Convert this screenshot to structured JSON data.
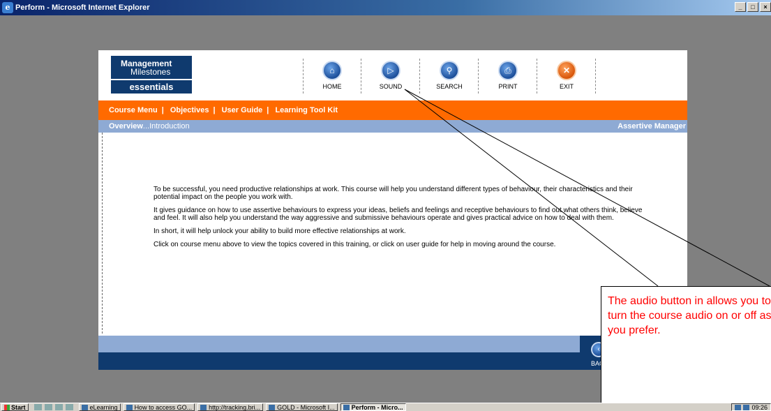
{
  "window": {
    "title": "Perform - Microsoft Internet Explorer",
    "controls": [
      "_",
      "□",
      "×"
    ]
  },
  "logo": {
    "line1": "Management",
    "line2": "Milestones",
    "line3": "essentials"
  },
  "toolbar": [
    {
      "label": "HOME",
      "icon": "home-icon",
      "glyph": "⌂"
    },
    {
      "label": "SOUND",
      "icon": "sound-icon",
      "glyph": "▷"
    },
    {
      "label": "SEARCH",
      "icon": "search-icon",
      "glyph": "⚲"
    },
    {
      "label": "PRINT",
      "icon": "print-icon",
      "glyph": "⎙"
    },
    {
      "label": "EXIT",
      "icon": "exit-icon",
      "glyph": "✕"
    }
  ],
  "menu": [
    "Course Menu",
    "Objectives",
    "User Guide",
    "Learning Tool Kit"
  ],
  "subbar": {
    "section": "Overview",
    "page": "...Introduction",
    "course": "Assertive Manager"
  },
  "body": [
    "To be successful, you need productive relationships at work. This course will help you understand different types of behaviour, their characteristics and their potential impact on the people you work with.",
    "It gives guidance on how to use assertive behaviours to express your ideas, beliefs and feelings and receptive behaviours to find out what others think, believe and feel. It will also help you understand the way aggressive and submissive behaviours operate and gives practical advice on how to deal with them.",
    "In short, it will help unlock your ability to build more effective relationships at work.",
    "Click on course menu above to view the topics covered in this training, or click on user guide for help in moving around the course."
  ],
  "back": {
    "label": "BACK",
    "glyph": "‹"
  },
  "callout": {
    "text": "The audio button in allows you to turn the course audio on or off as you prefer.",
    "color": "#ff0000"
  },
  "taskbar": {
    "start": "Start",
    "items": [
      {
        "label": "eLearning",
        "active": false
      },
      {
        "label": "How to access GO...",
        "active": false
      },
      {
        "label": "http://tracking.bri...",
        "active": false
      },
      {
        "label": "GOLD - Microsoft I...",
        "active": false
      },
      {
        "label": "Perform - Micro...",
        "active": true
      }
    ],
    "clock": "09:26"
  },
  "colors": {
    "orange": "#ff6a00",
    "navy": "#0f3a6e",
    "lightblue": "#8eaad4"
  }
}
